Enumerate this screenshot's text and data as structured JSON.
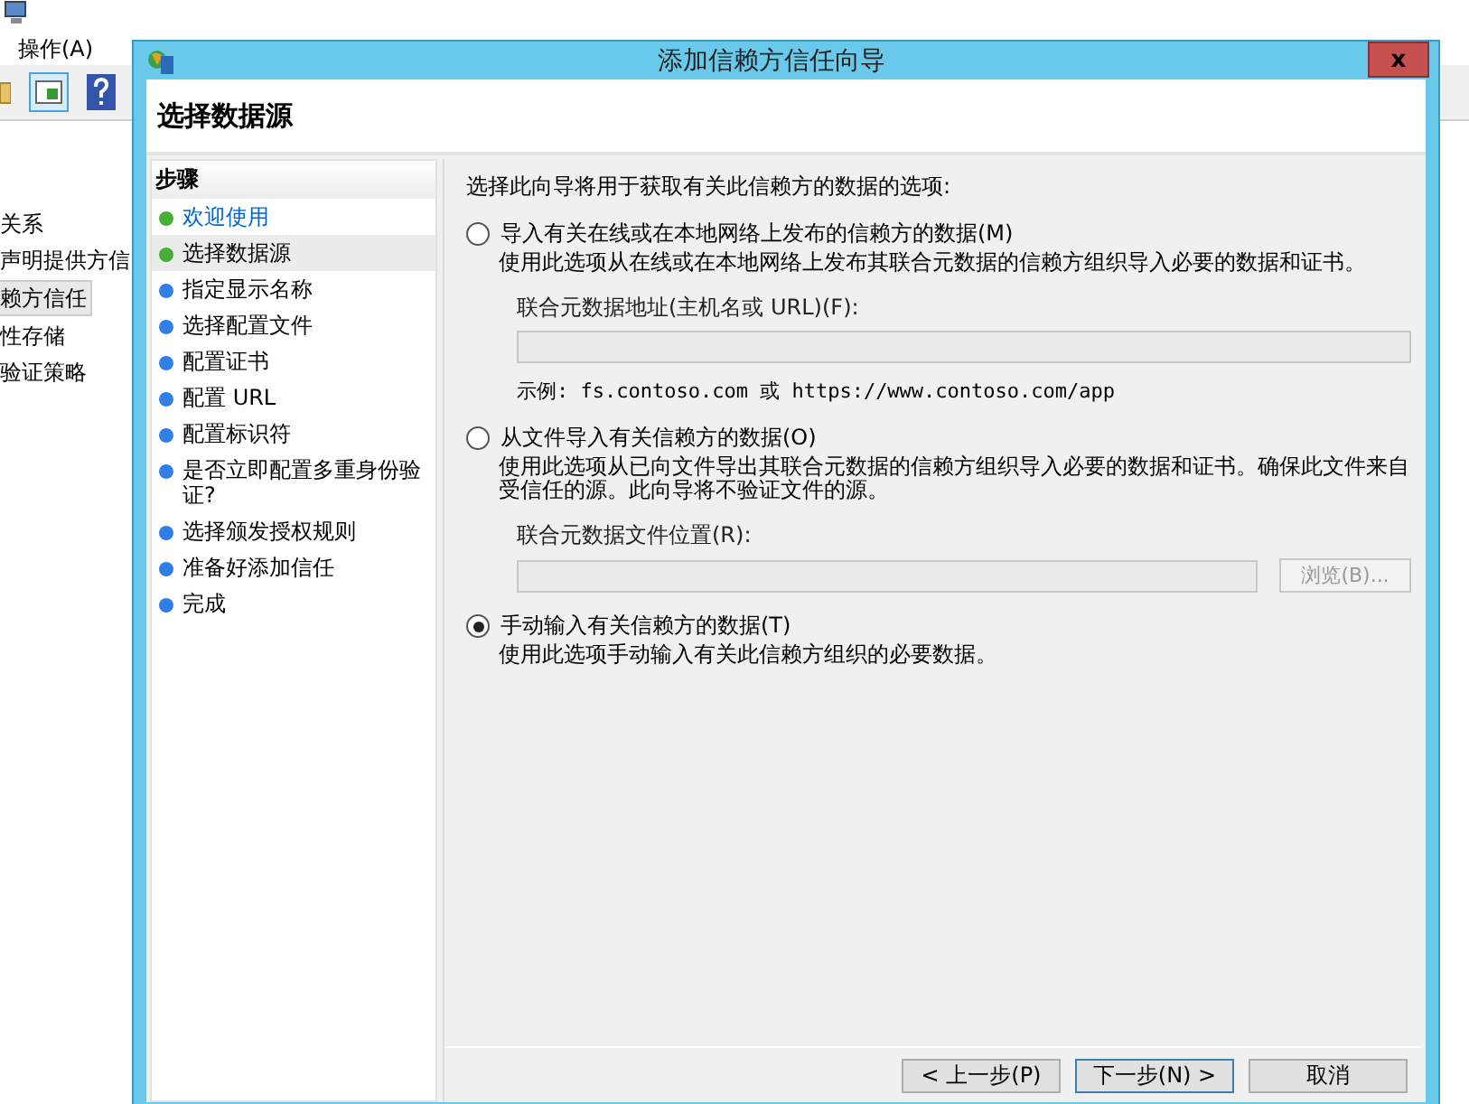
{
  "background_window": {
    "menu": [
      "操作(A)"
    ],
    "tree": [
      {
        "label": "关系",
        "selected": false
      },
      {
        "label": "声明提供方信",
        "selected": false
      },
      {
        "label": "赖方信任",
        "selected": true
      },
      {
        "label": "性存储",
        "selected": false
      },
      {
        "label": "验证策略",
        "selected": false
      }
    ]
  },
  "dialog": {
    "title": "添加信赖方信任向导",
    "close": "x",
    "header": "选择数据源",
    "steps_heading": "步骤",
    "steps": [
      {
        "label": "欢迎使用",
        "color": "#45b035",
        "link": true,
        "selected": false
      },
      {
        "label": "选择数据源",
        "color": "#45b035",
        "link": false,
        "selected": true
      },
      {
        "label": "指定显示名称",
        "color": "#2f7fe6",
        "link": false,
        "selected": false
      },
      {
        "label": "选择配置文件",
        "color": "#2f7fe6",
        "link": false,
        "selected": false
      },
      {
        "label": "配置证书",
        "color": "#2f7fe6",
        "link": false,
        "selected": false
      },
      {
        "label": "配置 URL",
        "color": "#2f7fe6",
        "link": false,
        "selected": false
      },
      {
        "label": "配置标识符",
        "color": "#2f7fe6",
        "link": false,
        "selected": false
      },
      {
        "label": "是否立即配置多重身份验证?",
        "color": "#2f7fe6",
        "link": false,
        "selected": false
      },
      {
        "label": "选择颁发授权规则",
        "color": "#2f7fe6",
        "link": false,
        "selected": false
      },
      {
        "label": "准备好添加信任",
        "color": "#2f7fe6",
        "link": false,
        "selected": false
      },
      {
        "label": "完成",
        "color": "#2f7fe6",
        "link": false,
        "selected": false
      }
    ],
    "intro": "选择此向导将用于获取有关此信赖方的数据的选项:",
    "options": [
      {
        "label": "导入有关在线或在本地网络上发布的信赖方的数据(M)",
        "selected": false,
        "description": "使用此选项从在线或在本地网络上发布其联合元数据的信赖方组织导入必要的数据和证书。",
        "field": {
          "label": "联合元数据地址(主机名或 URL)(F):",
          "disabled": true,
          "example": "示例: fs.contoso.com 或 https://www.contoso.com/app"
        }
      },
      {
        "label": "从文件导入有关信赖方的数据(O)",
        "selected": false,
        "description": "使用此选项从已向文件导出其联合元数据的信赖方组织导入必要的数据和证书。确保此文件来自受信任的源。此向导将不验证文件的源。",
        "field": {
          "label": "联合元数据文件位置(R):",
          "disabled": true,
          "browse": "浏览(B)..."
        }
      },
      {
        "label": "手动输入有关信赖方的数据(T)",
        "selected": true,
        "description": "使用此选项手动输入有关此信赖方组织的必要数据。"
      }
    ],
    "buttons": [
      {
        "label": "< 上一步(P)",
        "default": false
      },
      {
        "label": "下一步(N) >",
        "default": true
      },
      {
        "label": "取消",
        "default": false
      }
    ]
  }
}
